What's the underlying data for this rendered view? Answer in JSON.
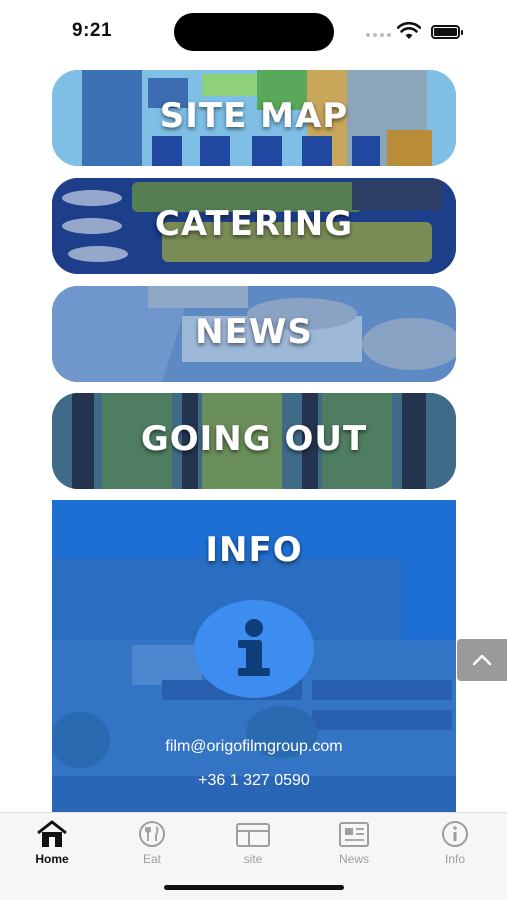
{
  "status_bar": {
    "time": "9:21"
  },
  "tiles": {
    "site_map": {
      "label": "SITE MAP"
    },
    "catering": {
      "label": "CATERING"
    },
    "news": {
      "label": "NEWS"
    },
    "going_out": {
      "label": "GOING OUT"
    },
    "info": {
      "label": "INFO",
      "email": "film@origofilmgroup.com",
      "phone": "+36 1 327 0590",
      "icon": "info-icon"
    }
  },
  "scroll_top_icon": "chevron-up-icon",
  "tab_bar": {
    "active": "Home",
    "items": [
      {
        "label": "Home",
        "icon": "home-icon"
      },
      {
        "label": "Eat",
        "icon": "fork-knife-icon"
      },
      {
        "label": "site",
        "icon": "layout-icon"
      },
      {
        "label": "News",
        "icon": "newspaper-icon"
      },
      {
        "label": "Info",
        "icon": "info-circle-icon"
      }
    ]
  },
  "colors": {
    "accent_blue": "#1f6fd0",
    "active_tab": "#111111",
    "inactive_tab": "#9e9e9e"
  }
}
